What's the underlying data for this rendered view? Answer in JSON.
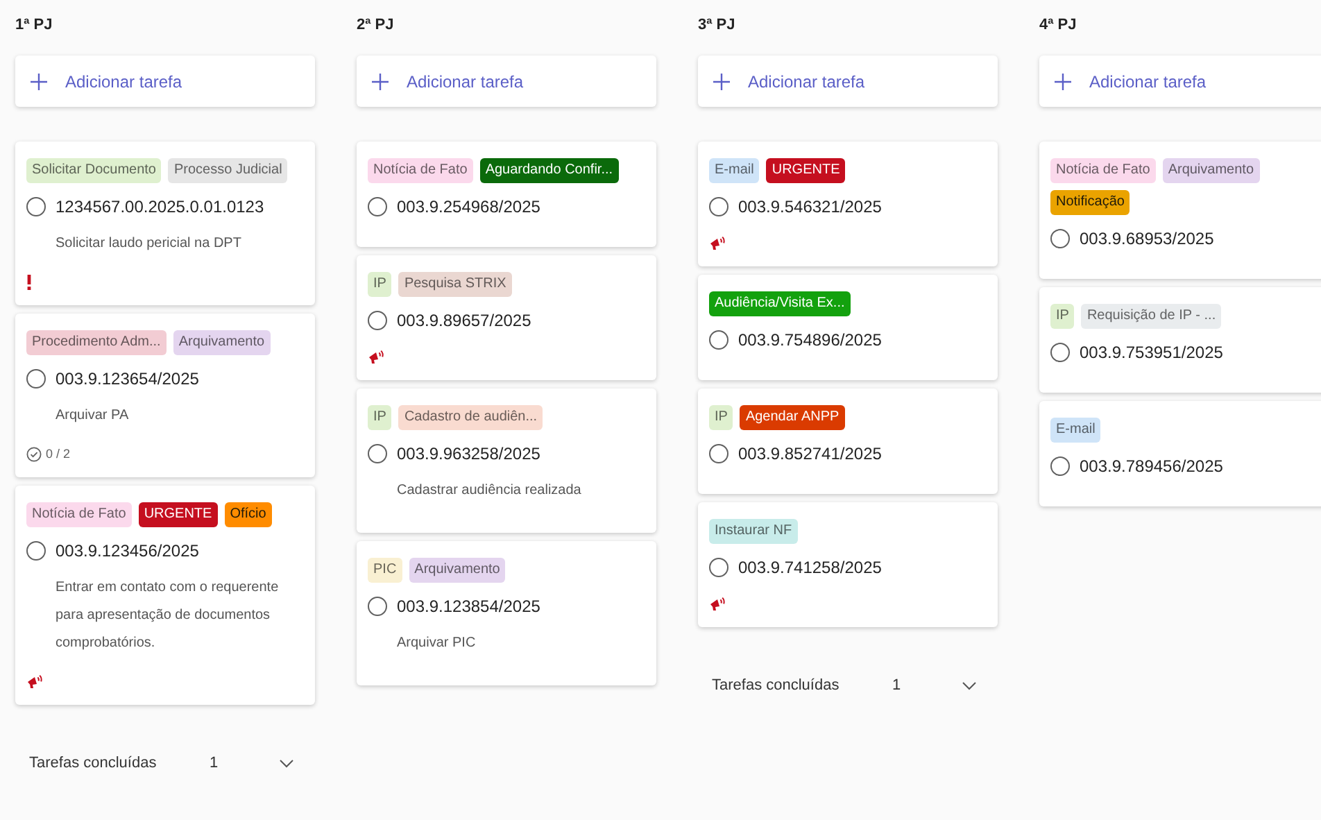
{
  "columns": [
    {
      "title": "1ª PJ",
      "add_task": "Adicionar tarefa",
      "tasks": [
        {
          "labels": [
            {
              "text": "Solicitar Documento",
              "color": "#dff0cf"
            },
            {
              "text": "Processo Judicial",
              "color": "#e6e6e6"
            }
          ],
          "checked": false,
          "title": "1234567.00.2025.0.01.0123",
          "note": "Solicitar laudo pericial na DPT",
          "indicator": {
            "kind": "priority"
          }
        },
        {
          "labels": [
            {
              "text": "Procedimento Adm...",
              "color": "#f2ccd3"
            },
            {
              "text": "Arquivamento",
              "color": "#e4d5ef"
            }
          ],
          "checked": false,
          "title": "003.9.123654/2025",
          "note": "Arquivar PA",
          "indicator": {
            "kind": "checklist",
            "text": "0 / 2"
          }
        },
        {
          "labels": [
            {
              "text": "Notícia de Fato",
              "color": "#fbd9ec"
            },
            {
              "text": "URGENTE",
              "color": "#c50f1f"
            },
            {
              "text": "Ofício",
              "color": "#ff8c00"
            }
          ],
          "checked": false,
          "title": "003.9.123456/2025",
          "note": "Entrar em contato com o requerente para apresentação de documentos comprobatórios.",
          "indicator": {
            "kind": "megaphone"
          }
        }
      ],
      "completed": {
        "label": "Tarefas concluídas",
        "count": "1"
      }
    },
    {
      "title": "2ª PJ",
      "add_task": "Adicionar tarefa",
      "tasks": [
        {
          "labels": [
            {
              "text": "Notícia de Fato",
              "color": "#fbd9ec"
            },
            {
              "text": "Aguardando Confir...",
              "color": "#0b6a0b"
            }
          ],
          "checked": false,
          "title": "003.9.254968/2025"
        },
        {
          "labels": [
            {
              "text": "IP",
              "color": "#dff0cf"
            },
            {
              "text": "Pesquisa STRIX",
              "color": "#ead7d1"
            }
          ],
          "checked": false,
          "title": "003.9.89657/2025",
          "indicator": {
            "kind": "megaphone"
          }
        },
        {
          "labels": [
            {
              "text": "IP",
              "color": "#dff0cf"
            },
            {
              "text": "Cadastro de audiên...",
              "color": "#f9dbd0"
            }
          ],
          "checked": false,
          "title": "003.9.963258/2025",
          "note": "Cadastrar audiência realizada"
        },
        {
          "labels": [
            {
              "text": "PIC",
              "color": "#f9f0d2"
            },
            {
              "text": "Arquivamento",
              "color": "#e4d5ef"
            }
          ],
          "checked": false,
          "title": "003.9.123854/2025",
          "note": "Arquivar PIC"
        }
      ]
    },
    {
      "title": "3ª PJ",
      "add_task": "Adicionar tarefa",
      "tasks": [
        {
          "labels": [
            {
              "text": "E-mail",
              "color": "#cfe4f8"
            },
            {
              "text": "URGENTE",
              "color": "#c50f1f"
            }
          ],
          "checked": false,
          "title": "003.9.546321/2025",
          "indicator": {
            "kind": "megaphone"
          }
        },
        {
          "labels": [
            {
              "text": "Audiência/Visita Ex...",
              "color": "#13a10e"
            }
          ],
          "checked": false,
          "title": "003.9.754896/2025"
        },
        {
          "labels": [
            {
              "text": "IP",
              "color": "#dff0cf"
            },
            {
              "text": "Agendar ANPP",
              "color": "#da3b01"
            }
          ],
          "checked": false,
          "title": "003.9.852741/2025"
        },
        {
          "labels": [
            {
              "text": "Instaurar NF",
              "color": "#c8ecea"
            }
          ],
          "checked": false,
          "title": "003.9.741258/2025",
          "indicator": {
            "kind": "megaphone"
          }
        }
      ],
      "completed": {
        "label": "Tarefas concluídas",
        "count": "1"
      }
    },
    {
      "title": "4ª PJ",
      "add_task": "Adicionar tarefa",
      "tasks": [
        {
          "labels": [
            {
              "text": "Notícia de Fato",
              "color": "#fbd9ec"
            },
            {
              "text": "Arquivamento",
              "color": "#e4d5ef"
            },
            {
              "text": "Notificação",
              "color": "#eaa300"
            }
          ],
          "checked": false,
          "title": "003.9.68953/2025"
        },
        {
          "labels": [
            {
              "text": "IP",
              "color": "#dff0cf"
            },
            {
              "text": "Requisição de IP - ...",
              "color": "#e9ecee"
            }
          ],
          "checked": false,
          "title": "003.9.753951/2025"
        },
        {
          "labels": [
            {
              "text": "E-mail",
              "color": "#cfe4f8"
            }
          ],
          "checked": false,
          "title": "003.9.789456/2025"
        }
      ]
    }
  ]
}
